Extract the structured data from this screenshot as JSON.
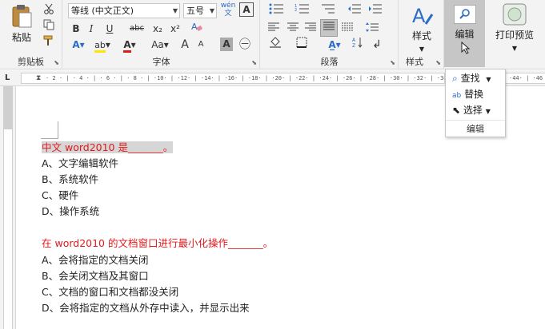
{
  "ribbon": {
    "clipboard": {
      "paste_label": "粘贴",
      "group_label": "剪贴板"
    },
    "font": {
      "font_name": "等线 (中文正文)",
      "font_size": "五号",
      "wen_label": "wén\n文",
      "bold": "B",
      "italic": "I",
      "underline": "U",
      "strike": "abc",
      "subscript": "x₂",
      "superscript": "x²",
      "grow": "A",
      "shrink": "A",
      "case": "Aa",
      "char_shade": "A",
      "enclose": "㊀",
      "group_label": "字体"
    },
    "paragraph": {
      "group_label": "段落"
    },
    "styles": {
      "styles_label": "样式",
      "group_label": "样式"
    },
    "editing": {
      "edit_label": "编辑"
    },
    "print": {
      "print_label": "打印预览"
    }
  },
  "dropdown": {
    "find": "查找",
    "replace": "替换",
    "select": "选择",
    "group_label": "编辑"
  },
  "ruler": {
    "ticks": "· 2 · | · 4 · | · 6 · | · 8 · | ·10· | ·12· | ·14· | ·16· | ·18· | ·20· | ·22· | ·24· | ·26· | ·28· | ·30· | ·32· | ·34· | ·36·",
    "right_ticks": "·44· | ·46"
  },
  "document": {
    "lines": [
      {
        "text": "中文 word2010 是_______。",
        "style": "red-hl"
      },
      {
        "text": "A、文字编辑软件",
        "style": "normal"
      },
      {
        "text": "B、系统软件",
        "style": "normal"
      },
      {
        "text": "C、硬件",
        "style": "normal"
      },
      {
        "text": "D、操作系统",
        "style": "normal"
      },
      {
        "text": "",
        "style": "normal"
      },
      {
        "text": "在 word2010 的文档窗口进行最小化操作_______。",
        "style": "red"
      },
      {
        "text": "A、会将指定的文档关闭",
        "style": "normal"
      },
      {
        "text": "B、会关闭文档及其窗口",
        "style": "normal"
      },
      {
        "text": "C、文档的窗口和文档都没关闭",
        "style": "normal"
      },
      {
        "text": "D、会将指定的文档从外存中读入，并显示出来",
        "style": "normal"
      }
    ]
  },
  "colors": {
    "accent_red": "#e0191b",
    "highlight_gray": "#d6d6d6",
    "edit_blue": "#2b6cc4"
  }
}
